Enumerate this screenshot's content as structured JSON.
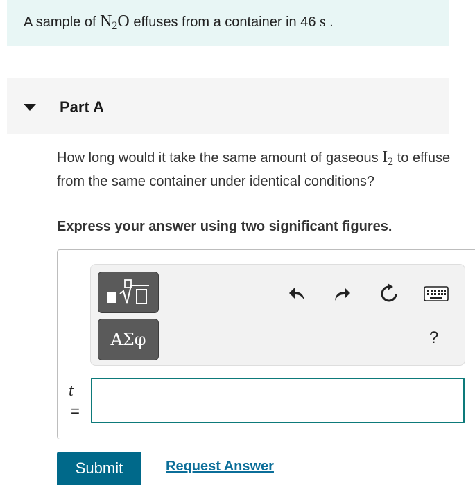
{
  "intro": {
    "prefix": "A sample of",
    "formula_main": "N",
    "formula_sub": "2",
    "formula_tail": "O",
    "suffix": "effuses from a container in 46",
    "unit": "s",
    "end": "."
  },
  "part": {
    "title": "Part A"
  },
  "question": {
    "text_before": "How long would it take the same amount of gaseous",
    "element": "I",
    "element_sub": "2",
    "text_after": "to effuse from the same container under identical conditions?"
  },
  "instruction": "Express your answer using two significant figures.",
  "toolbar": {
    "greek_label": "ΑΣφ",
    "help_label": "?"
  },
  "answer": {
    "variable": "t",
    "equals": "=",
    "value": "",
    "placeholder": ""
  },
  "actions": {
    "submit_label": "Submit",
    "request_label": "Request Answer"
  },
  "colors": {
    "intro_bg": "#e8f6f5",
    "accent": "#0d7a7a",
    "submit_bg": "#00698a",
    "link": "#0b6e99"
  }
}
